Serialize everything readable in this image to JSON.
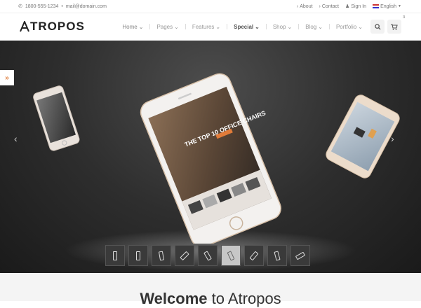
{
  "topbar": {
    "phone": "1800-555-1234",
    "email": "mail@domain.com",
    "links": [
      {
        "label": "About"
      },
      {
        "label": "Contact"
      },
      {
        "label": "Sign In"
      },
      {
        "label": "English"
      }
    ]
  },
  "brand": {
    "name": "TROPOS",
    "accent": "#222222"
  },
  "nav": {
    "items": [
      {
        "label": "Home"
      },
      {
        "label": "Pages"
      },
      {
        "label": "Features"
      },
      {
        "label": "Special"
      },
      {
        "label": "Shop"
      },
      {
        "label": "Blog"
      },
      {
        "label": "Portfolio"
      }
    ],
    "cart_count": "3"
  },
  "hero": {
    "phone_screen_text": "THE TOP 10 OFFICE CHAIRS",
    "accent": "#e07b39",
    "thumbnail_count": 9,
    "active_thumbnail": 6
  },
  "welcome": {
    "bold": "Welcome",
    "rest": " to Atropos"
  }
}
